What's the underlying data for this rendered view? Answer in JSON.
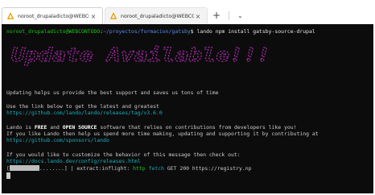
{
  "tabs": [
    {
      "label": "noroot_drupaladicto@WEBCON",
      "close": "×"
    },
    {
      "label": "noroot_drupaladicto@WEBCON",
      "close": "×"
    }
  ],
  "tabbar": {
    "new_tab": "+",
    "dropdown": "⌄"
  },
  "terminal": {
    "prompt_user": "noroot_drupaladicto@WEBCONTODO",
    "prompt_colon": ":",
    "prompt_path": "~/proyectos/formacion/gatsby",
    "prompt_dollar": "$ ",
    "command": "lando npm install gatsby-source-drupal",
    "banner_text": "Update Available!!!",
    "updating": "Updating helps us provide the best support and saves us tons of time",
    "use_link": "Use the link below to get the latest and greatest",
    "release_url": "https://github.com/lando/lando/releases/tag/v3.6.0",
    "lando_pre": "Lando is ",
    "lando_free": "FREE",
    "lando_and": " and ",
    "lando_oss": "OPEN SOURCE",
    "lando_post": " software that relies on contributions from developers like you!",
    "if_like": "If you like Lando then help us spend more time making, updating and supporting it by contributing at",
    "sponsors_url": "https://github.com/sponsors/lando",
    "customize": "If you would like to customize the behavior of this message then check out:",
    "docs_url": "https://docs.lando.dev/config/releases.html",
    "progress_open": "[",
    "progress_dots": "........",
    "progress_close": "] | extract:inflight: ",
    "progress_http": "http",
    "progress_fetch": " fetch",
    "progress_rest": " GET 200 https://registry.np"
  },
  "colors": {
    "prompt_green": "#19c919",
    "path_blue": "#5c8df0",
    "link_cyan": "#18b2bf",
    "banner_magenta": "#b02bb0",
    "terminal_bg": "#0c0c0c"
  },
  "icons": [
    "linux-penguin-icon",
    "close-icon",
    "plus-icon",
    "chevron-down-icon"
  ]
}
